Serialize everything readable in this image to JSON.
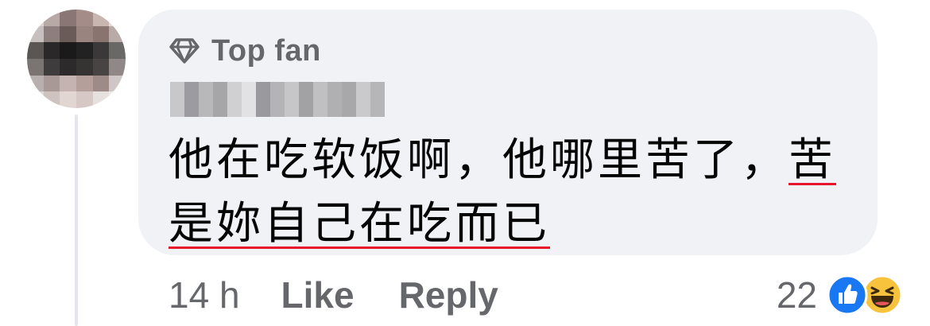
{
  "comment": {
    "badge_label": "Top fan",
    "text_plain": "他在吃软饭啊，他哪里苦了，",
    "text_underlined_1": "苦",
    "text_underlined_2": "是妳自己在吃而已"
  },
  "actions": {
    "time": "14 h",
    "like_label": "Like",
    "reply_label": "Reply"
  },
  "reactions": {
    "count": "22",
    "icons": [
      "like-icon",
      "haha-icon"
    ]
  },
  "colors": {
    "bubble_bg": "#f0f2f5",
    "secondary_text": "#65676b",
    "like_blue": "#1877f2",
    "spellcheck_red": "#e4182a"
  }
}
